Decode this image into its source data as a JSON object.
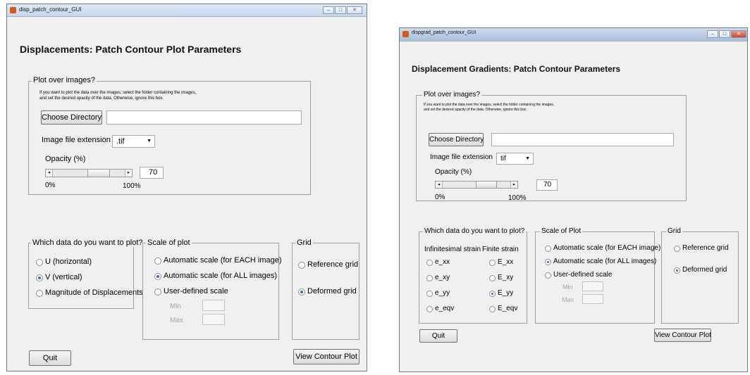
{
  "left": {
    "window_title": "disp_patch_contour_GUI",
    "heading": "Displacements:  Patch Contour Plot Parameters",
    "plot_over_images": {
      "legend": "Plot over images?",
      "instructions_line1": "If you want to plot the data over the images, select the folder containing the images,",
      "instructions_line2": "and set the desired opacity of the data.  Otherwise, ignore this box.",
      "choose_directory": "Choose Directory",
      "directory_value": "",
      "ext_label": "Image file extension",
      "ext_value": ".tif",
      "opacity_label": "Opacity (%)",
      "opacity_value": "70",
      "min_label": "0%",
      "max_label": "100%"
    },
    "which_data": {
      "legend": "Which data do you want to plot?",
      "options": [
        "U (horizontal)",
        "V (vertical)",
        "Magnitude of Displacements"
      ],
      "selected": "V (vertical)"
    },
    "scale": {
      "legend": "Scale of plot",
      "options": [
        "Automatic scale (for EACH image)",
        "Automatic scale (for ALL images)",
        "User-defined scale"
      ],
      "selected": "Automatic scale (for ALL images)",
      "min_label": "Min",
      "max_label": "Max"
    },
    "grid": {
      "legend": "Grid",
      "options": [
        "Reference grid",
        "Deformed grid"
      ],
      "selected": "Deformed grid"
    },
    "quit": "Quit",
    "view": "View Contour Plot"
  },
  "right": {
    "window_title": "dispgrad_patch_contour_GUI",
    "heading": "Displacement Gradients:  Patch Contour Parameters",
    "plot_over_images": {
      "legend": "Plot over images?",
      "instructions_line1": "If you want to plot the data over the images, select the folder containing the images,",
      "instructions_line2": "and set the desired opacity of the data.  Otherwise, ignore this box.",
      "choose_directory": "Choose Directory",
      "directory_value": "",
      "ext_label": "Image file extension",
      "ext_value": "tif",
      "opacity_label": "Opacity (%)",
      "opacity_value": "70",
      "min_label": "0%",
      "max_label": "100%"
    },
    "which_data": {
      "legend": "Which data do you want to plot?",
      "col1_header": "Infinitesimal strain",
      "col2_header": "Finite strain",
      "col1": [
        "e_xx",
        "e_xy",
        "e_yy",
        "e_eqv"
      ],
      "col2": [
        "E_xx",
        "E_xy",
        "E_yy",
        "E_eqv"
      ],
      "selected": "E_yy"
    },
    "scale": {
      "legend": "Scale of Plot",
      "options": [
        "Automatic scale (for EACH image)",
        "Automatic scale (for ALL images)",
        "User-defined scale"
      ],
      "selected": "Automatic scale (for ALL images)",
      "min_label": "Min",
      "max_label": "Max"
    },
    "grid": {
      "legend": "Grid",
      "options": [
        "Reference grid",
        "Deformed grid"
      ],
      "selected": "Deformed grid"
    },
    "quit": "Quit",
    "view": "View Contour Plot"
  },
  "opacity_fraction": 0.7
}
